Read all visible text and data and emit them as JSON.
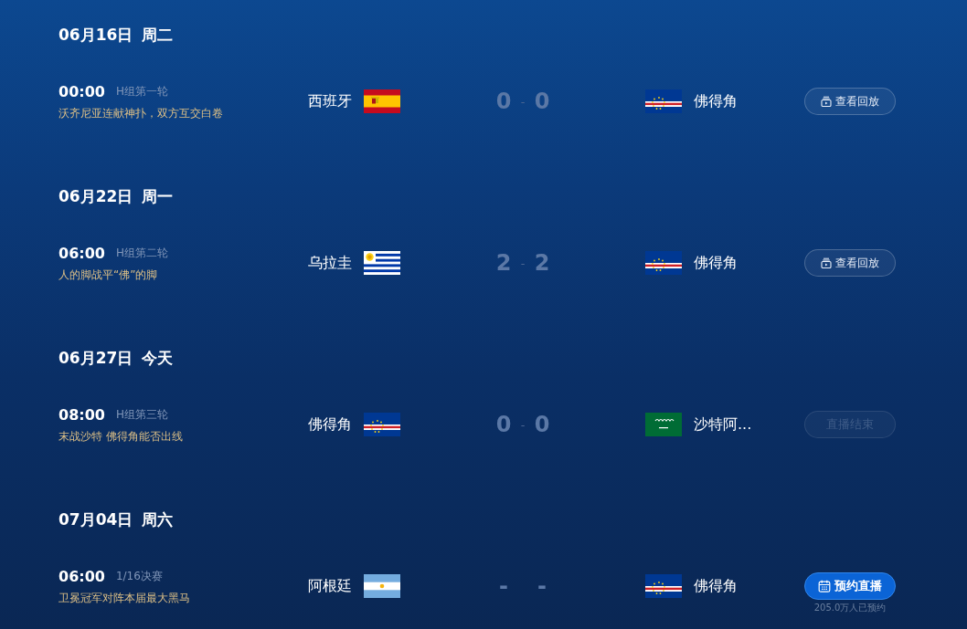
{
  "days": [
    {
      "date": "06月16日",
      "weekday": "周二",
      "matches": [
        {
          "time": "00:00",
          "stage": "H组第一轮",
          "headline": "沃齐尼亚连献神扑，双方互交白卷",
          "home": {
            "name": "西班牙",
            "kind": "spain"
          },
          "score": {
            "home": "0",
            "separator": "-",
            "away": "0"
          },
          "away": {
            "name": "佛得角",
            "kind": "capeverde"
          },
          "action": {
            "kind": "replay",
            "label": "查看回放"
          }
        }
      ]
    },
    {
      "date": "06月22日",
      "weekday": "周一",
      "matches": [
        {
          "time": "06:00",
          "stage": "H组第二轮",
          "headline": "人的脚战平“佛”的脚",
          "home": {
            "name": "乌拉圭",
            "kind": "uruguay"
          },
          "score": {
            "home": "2",
            "separator": "-",
            "away": "2"
          },
          "away": {
            "name": "佛得角",
            "kind": "capeverde"
          },
          "action": {
            "kind": "replay",
            "label": "查看回放"
          }
        }
      ]
    },
    {
      "date": "06月27日",
      "weekday": "今天",
      "matches": [
        {
          "time": "08:00",
          "stage": "H组第三轮",
          "headline": "末战沙特 佛得角能否出线",
          "home": {
            "name": "佛得角",
            "kind": "capeverde"
          },
          "score": {
            "home": "0",
            "separator": "-",
            "away": "0"
          },
          "away": {
            "name": "沙特阿...",
            "kind": "saudi"
          },
          "action": {
            "kind": "ended",
            "label": "直播结束"
          }
        }
      ]
    },
    {
      "date": "07月04日",
      "weekday": "周六",
      "matches": [
        {
          "time": "06:00",
          "stage": "1/16决赛",
          "headline": "卫冕冠军对阵本届最大黑马",
          "home": {
            "name": "阿根廷",
            "kind": "argentina"
          },
          "score": {
            "home": "-",
            "away": "-"
          },
          "away": {
            "name": "佛得角",
            "kind": "capeverde"
          },
          "action": {
            "kind": "reserve",
            "label": "预约直播",
            "note": "205.0万人已预约"
          }
        }
      ]
    }
  ]
}
